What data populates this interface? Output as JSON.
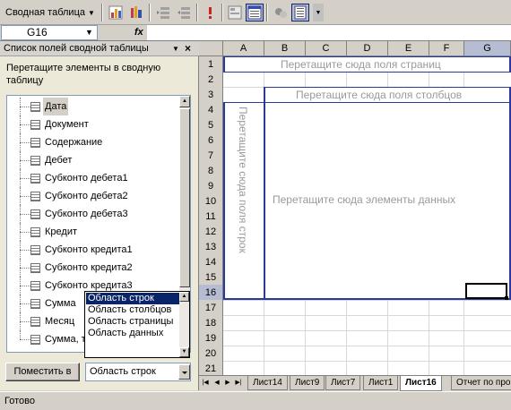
{
  "toolbar": {
    "pivot_menu_label": "Сводная таблица",
    "icons": [
      "pivot-chart-icon",
      "pivot-wizard-icon",
      "hide-detail-icon",
      "show-detail-icon",
      "refresh-icon",
      "field-settings-icon",
      "format-report-icon",
      "field-list-icon"
    ]
  },
  "formula_bar": {
    "name_box": "G16",
    "fx_label": "fx",
    "formula": ""
  },
  "pane": {
    "title": "Список полей сводной таблицы",
    "instruction": "Перетащите элементы в сводную таблицу",
    "fields": [
      "Дата",
      "Документ",
      "Содержание",
      "Дебет",
      "Субконто дебета1",
      "Субконто дебета2",
      "Субконто дебета3",
      "Кредит",
      "Субконто кредита1",
      "Субконто кредита2",
      "Субконто кредита3",
      "Сумма",
      "Месяц",
      "Сумма, т.р."
    ],
    "selected_field": "Дата",
    "dropdown_options": [
      "Область строк",
      "Область столбцов",
      "Область страницы",
      "Область данных"
    ],
    "dropdown_highlighted": "Область строк",
    "put_button_label": "Поместить в",
    "area_select_value": "Область строк"
  },
  "grid": {
    "columns": [
      "A",
      "B",
      "C",
      "D",
      "E",
      "F",
      "G"
    ],
    "active_column": "G",
    "rows": [
      "1",
      "2",
      "3",
      "4",
      "5",
      "6",
      "7",
      "8",
      "9",
      "10",
      "11",
      "12",
      "13",
      "14",
      "15",
      "16",
      "17",
      "18",
      "19",
      "20",
      "21"
    ],
    "active_row": "16",
    "drop_page_fields": "Перетащите сюда поля страниц",
    "drop_column_fields": "Перетащите сюда поля столбцов",
    "drop_row_fields": "Перетащите сюда поля строк",
    "drop_data_items": "Перетащите сюда элементы данных"
  },
  "sheet_tabs": {
    "tabs": [
      "Лист14",
      "Лист9",
      "Лист7",
      "Лист1",
      "Лист16",
      "Отчет по про"
    ],
    "active": "Лист16"
  },
  "status": {
    "text": "Готово"
  },
  "colors": {
    "pivot_border": "#2a3a9a",
    "placeholder_text": "#9a9a9a",
    "selection": "#0a246a"
  }
}
